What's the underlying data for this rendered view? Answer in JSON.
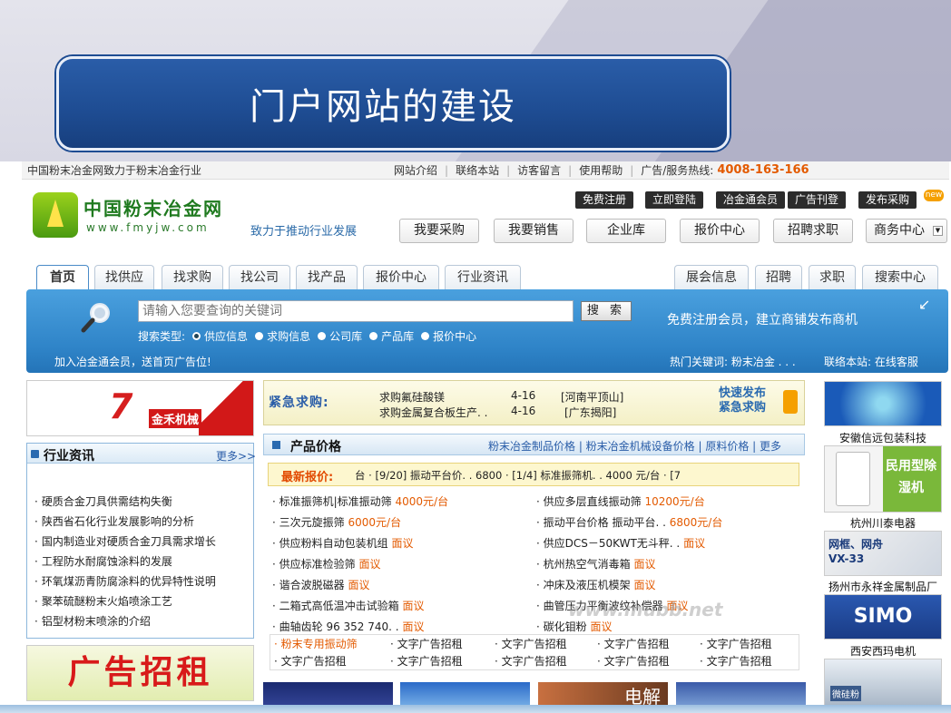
{
  "slide": {
    "title": "门户网站的建设"
  },
  "topbar": {
    "slogan": "中国粉末冶金网致力于粉末冶金行业",
    "links": [
      "网站介绍",
      "联络本站",
      "访客留言",
      "使用帮助"
    ],
    "ad_label": "广告/服务热线:",
    "hotline": "4008-163-166"
  },
  "logo": {
    "name": "中国粉末冶金网",
    "url": "www.fmyjw.com",
    "slogan": "致力于推动行业发展"
  },
  "top_buttons": [
    "免费注册",
    "立即登陆",
    "冶金通会员",
    "广告刊登",
    "发布采购"
  ],
  "new_badge": "new",
  "nav_buttons": [
    "我要采购",
    "我要销售",
    "企业库",
    "报价中心",
    "招聘求职",
    "商务中心"
  ],
  "tabs_left": [
    "首页",
    "找供应",
    "找求购",
    "找公司",
    "找产品",
    "报价中心",
    "行业资讯"
  ],
  "tabs_right": [
    "展会信息",
    "招聘",
    "求职",
    "搜索中心"
  ],
  "search": {
    "placeholder": "请输入您要查询的关键词",
    "button": "搜 索",
    "type_label": "搜索类型:",
    "types": [
      "供应信息",
      "求购信息",
      "公司库",
      "产品库",
      "报价中心"
    ],
    "promo": "免费注册会员，建立商铺发布商机",
    "join": "加入冶金通会员，送首页广告位!",
    "hot_keywords": "热门关键词: 粉末冶金 . . .",
    "contact": "联络本站: 在线客服"
  },
  "ad_left_top": "金禾机械",
  "news": {
    "title": "行业资讯",
    "more": "更多>>",
    "items": [
      "硬质合金刀具供需结构失衡",
      "陕西省石化行业发展影响的分析",
      "国内制造业对硬质合金刀具需求增长",
      "工程防水耐腐蚀涂料的发展",
      "环氧煤沥青防腐涂料的优异特性说明",
      "聚苯硫醚粉末火焰喷涂工艺",
      "铝型材粉末喷涂的介绍"
    ]
  },
  "ad_left_bottom": "广告招租",
  "urgent": {
    "label": "紧急求购:",
    "rows": [
      {
        "item": "求购氟硅酸镁",
        "date": "4-16",
        "place": "[河南平顶山]"
      },
      {
        "item": "求购金属复合板生产. .",
        "date": "4-16",
        "place": "[广东揭阳]"
      }
    ],
    "button_line1": "快速发布",
    "button_line2": "紧急求购"
  },
  "products": {
    "title": "产品价格",
    "links": "粉末冶金制品价格 | 粉末冶金机械设备价格 | 原料价格 | 更多",
    "quote_label": "最新报价:",
    "quote_text": "台 · [9/20] 振动平台价. . 6800 · [1/4] 标准振筛机. . 4000 元/台 · [7",
    "left": [
      {
        "name": "标准振筛机|标准振动筛",
        "price": "4000元/台"
      },
      {
        "name": "三次元旋振筛",
        "price": "6000元/台"
      },
      {
        "name": "供应粉料自动包装机组",
        "price": "面议"
      },
      {
        "name": "供应标准检验筛",
        "price": "面议"
      },
      {
        "name": "谐合波脱磁器",
        "price": "面议"
      },
      {
        "name": "二箱式高低温冲击试验箱",
        "price": "面议"
      },
      {
        "name": "曲轴齿轮 96 352 740. .",
        "price": "面议"
      }
    ],
    "right": [
      {
        "name": "供应多层直线振动筛",
        "price": "10200元/台"
      },
      {
        "name": "振动平台价格 振动平台. .",
        "price": "6800元/台"
      },
      {
        "name": "供应DCS－50KWT无斗秤. .",
        "price": "面议"
      },
      {
        "name": "杭州热空气消毒箱",
        "price": "面议"
      },
      {
        "name": "冲床及液压机模架",
        "price": "面议"
      },
      {
        "name": "曲管压力平衡波纹补偿器",
        "price": "面议"
      },
      {
        "name": "碳化钼粉",
        "price": "面议"
      }
    ],
    "ads_row1": [
      "粉末专用振动筛",
      "文字广告招租",
      "文字广告招租",
      "文字广告招租",
      "文字广告招租"
    ],
    "ads_row2": [
      "文字广告招租",
      "文字广告招租",
      "文字广告招租",
      "文字广告招租",
      "文字广告招租"
    ]
  },
  "watermark": "www.mubb.net",
  "bottom_strip": {
    "label_dianjie": "电解"
  },
  "right_ads": [
    {
      "label": "安徽信远包装科技"
    },
    {
      "label": "杭州川泰电器",
      "ad_text": "民用型除湿机"
    },
    {
      "label": "扬州市永祥金属制品厂",
      "ad_text": "网框、网舟VX-33"
    },
    {
      "label": "西安西玛电机",
      "ad_text": "SIMO"
    },
    {
      "label": "",
      "ad_text": "微硅粉"
    }
  ],
  "colors": {
    "brand_blue": "#2a5da8",
    "price_orange": "#e35a00",
    "search_blue": "#2f84c8"
  }
}
